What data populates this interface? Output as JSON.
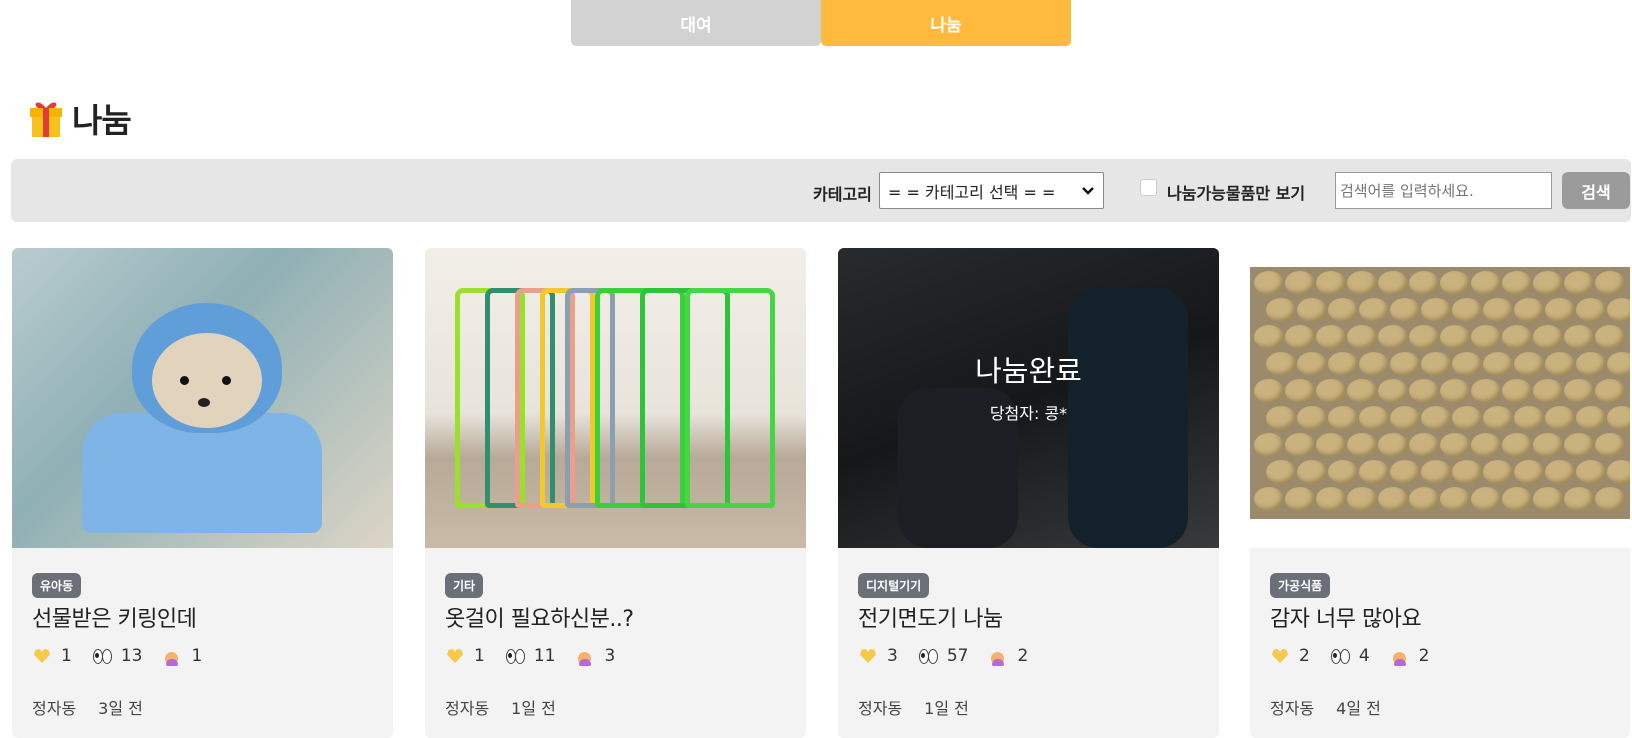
{
  "tabs": {
    "rent": "대여",
    "share": "나눔"
  },
  "page": {
    "title": "나눔"
  },
  "filter": {
    "category_label": "카테고리",
    "category_selected": "= = 카테고리 선택 = =",
    "available_only_label": "나눔가능물품만 보기",
    "search_placeholder": "검색어를 입력하세요.",
    "search_button": "검색"
  },
  "items": [
    {
      "category": "유아동",
      "title": "선물받은 키링인데",
      "likes": "1",
      "views": "13",
      "applicants": "1",
      "location": "정자동",
      "time": "3일 전"
    },
    {
      "category": "기타",
      "title": "옷걸이 필요하신분..?",
      "likes": "1",
      "views": "11",
      "applicants": "3",
      "location": "정자동",
      "time": "1일 전"
    },
    {
      "category": "디지털기기",
      "title": "전기면도기 나눔",
      "likes": "3",
      "views": "57",
      "applicants": "2",
      "location": "정자동",
      "time": "1일 전",
      "overlay": {
        "status": "나눔완료",
        "winner": "당첨자: 콩*"
      }
    },
    {
      "category": "가공식품",
      "title": "감자 너무 많아요",
      "likes": "2",
      "views": "4",
      "applicants": "2",
      "location": "정자동",
      "time": "4일 전"
    }
  ],
  "colors": {
    "share_tab": "#ffb93d",
    "rent_tab": "#d2d2d2",
    "badge": "#6b6f78"
  },
  "icons": {
    "like": "yellow-heart-icon",
    "view": "eyes-icon",
    "applicant": "raising-hand-icon",
    "gift": "gift-icon"
  }
}
